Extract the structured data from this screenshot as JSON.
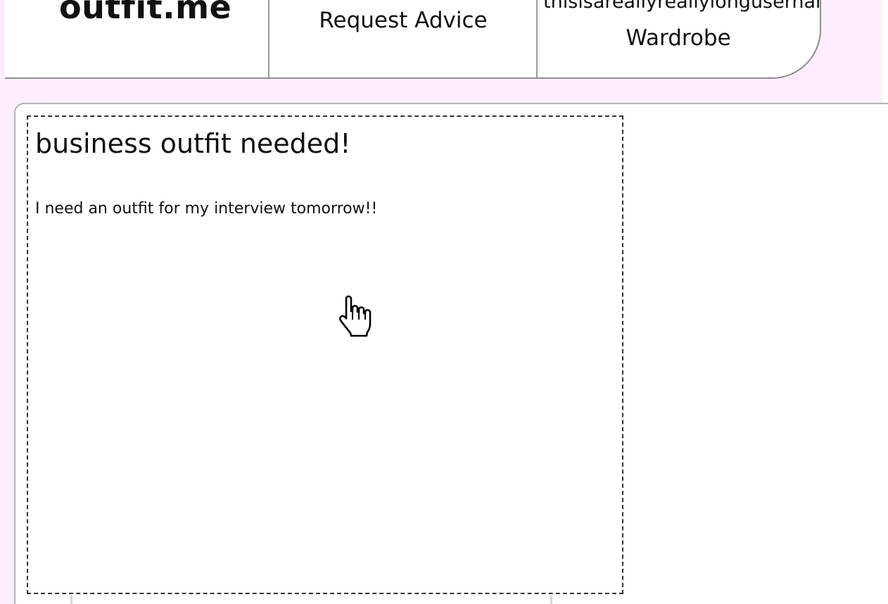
{
  "navbar": {
    "logo": "outfit.me",
    "request_advice_label": "Request Advice",
    "username": "thisisareallyreallylongusername",
    "wardrobe_label": "Wardrobe"
  },
  "request": {
    "title": "business outfit needed!",
    "body": "I need an outfit for my interview tomorrow!!"
  },
  "cursor": {
    "icon": "hand-pointer-icon"
  },
  "colors": {
    "page_background": "#fdeefd",
    "panel_background": "#ffffff",
    "border": "#8c8c8c",
    "card_border": "#333333"
  }
}
